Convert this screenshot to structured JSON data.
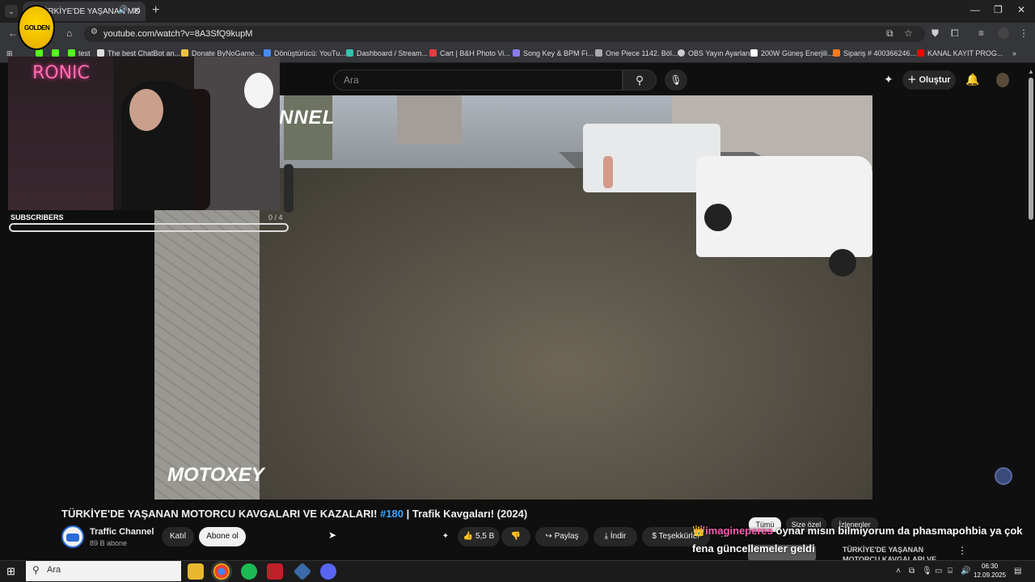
{
  "browser": {
    "tab_title": "TÜRKİYE'DE YAŞANAN MO",
    "url": "youtube.com/watch?v=8A3SfQ9kupM",
    "bookmarks": [
      "test",
      "The best ChatBot an...",
      "Donate ByNoGame...",
      "Dönüştürücü: YouTu...",
      "Dashboard / Stream...",
      "Cart | B&H Photo Vi...",
      "Song Key & BPM Fi...",
      "One Piece 1142. Böl...",
      "OBS Yayın Ayarları",
      "200W Güneş Enerjili...",
      "Sipariş # 400366246...",
      "KANAL KAYIT PROG..."
    ]
  },
  "youtube": {
    "search_placeholder": "Ara",
    "create_label": "Oluştur",
    "video_watermark_top": "NNEL",
    "video_watermark_bottom": "MOTOXEY",
    "title_prefix": "TÜRKİYE'DE YAŞANAN MOTORCU KAVGALARI VE KAZALARI!",
    "title_tag": "#180",
    "title_suffix": "| Trafik Kavgaları! (2024)",
    "channel_name": "Traffic Channel",
    "channel_subs": "89 B abone",
    "join_label": "Katıl",
    "subscribe_label": "Abone ol",
    "likes": "5,5 B",
    "share_label": "Paylaş",
    "download_label": "İndir",
    "thanks_label": "Teşekkürler",
    "more_label": "···",
    "chips": [
      "Tümü",
      "Size özel",
      "İzlenenler"
    ],
    "rec_title": "TÜRKİYE'DE YAŞANAN MOTORCU KAVGALARI VE"
  },
  "overlay": {
    "neon_text": "RONIC",
    "logo_text": "GOLDEN",
    "subscribers_label": "SUBSCRIBERS",
    "subscribers_count": "0 / 4",
    "subscribers_progress": 0,
    "chat_user": "imagineperes",
    "chat_message": "oynar mısın bilmiyorum da phasmapohbia ya çok fena güncellemeler geldi"
  },
  "taskbar": {
    "search_placeholder": "Ara",
    "time": "06:30",
    "date": "12.09.2025"
  },
  "colors": {
    "yt_bg": "#0f0f0f",
    "link_blue": "#3ea6ff",
    "chat_user": "#ff5bb0",
    "progress_fill": "#7ee06a"
  }
}
